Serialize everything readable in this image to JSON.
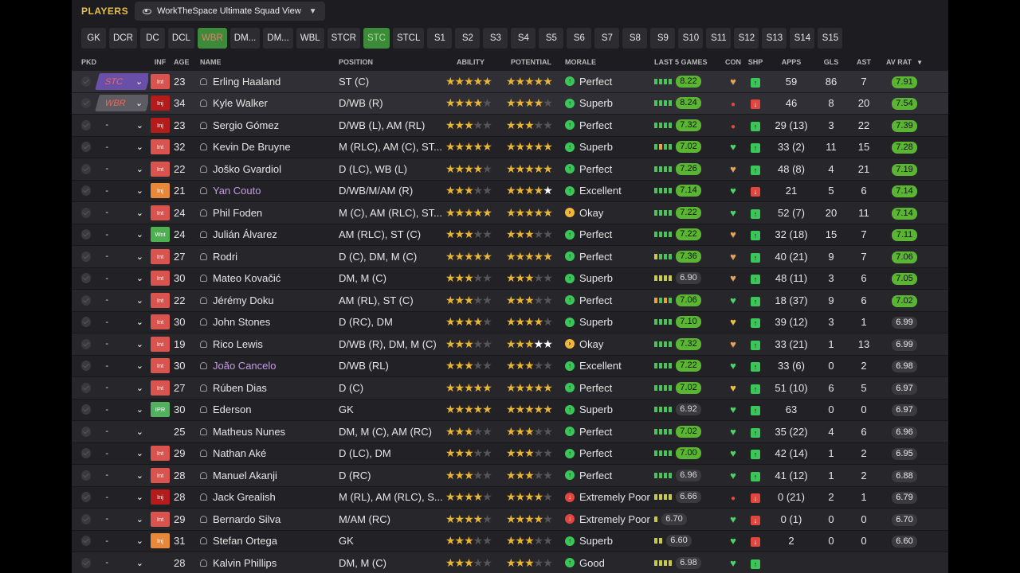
{
  "header": {
    "title": "PLAYERS",
    "view": "WorkTheSpace Ultimate Squad View"
  },
  "positions": [
    {
      "label": "GK",
      "state": ""
    },
    {
      "label": "DCR",
      "state": ""
    },
    {
      "label": "DC",
      "state": ""
    },
    {
      "label": "DCL",
      "state": ""
    },
    {
      "label": "WBR",
      "state": "active"
    },
    {
      "label": "DM...",
      "state": ""
    },
    {
      "label": "DM...",
      "state": ""
    },
    {
      "label": "WBL",
      "state": ""
    },
    {
      "label": "STCR",
      "state": ""
    },
    {
      "label": "STC",
      "state": "active2"
    },
    {
      "label": "STCL",
      "state": ""
    },
    {
      "label": "S1",
      "state": ""
    },
    {
      "label": "S2",
      "state": ""
    },
    {
      "label": "S3",
      "state": ""
    },
    {
      "label": "S4",
      "state": ""
    },
    {
      "label": "S5",
      "state": ""
    },
    {
      "label": "S6",
      "state": ""
    },
    {
      "label": "S7",
      "state": ""
    },
    {
      "label": "S8",
      "state": ""
    },
    {
      "label": "S9",
      "state": ""
    },
    {
      "label": "S10",
      "state": ""
    },
    {
      "label": "S11",
      "state": ""
    },
    {
      "label": "S12",
      "state": ""
    },
    {
      "label": "S13",
      "state": ""
    },
    {
      "label": "S14",
      "state": ""
    },
    {
      "label": "S15",
      "state": ""
    }
  ],
  "columns": {
    "pkd": "PKD",
    "inf": "INF",
    "age": "AGE",
    "name": "NAME",
    "position": "POSITION",
    "ability": "ABILITY",
    "potential": "POTENTIAL",
    "morale": "MORALE",
    "last5": "LAST 5 GAMES",
    "con": "CON",
    "shp": "SHP",
    "apps": "APPS",
    "gls": "GLS",
    "ast": "AST",
    "avrat": "AV RAT"
  },
  "players": [
    {
      "pick": "STC",
      "pickSel": "sel",
      "inf": "Int",
      "infType": "int",
      "age": "23",
      "name": "Erling Haaland",
      "loan": false,
      "position": "ST (C)",
      "ability": 5,
      "potential": 5,
      "potWhite": 0,
      "moraleIcon": "g",
      "morale": "Perfect",
      "bars": "gggg",
      "l5": "8.22",
      "l5g": true,
      "con": "h-o",
      "shp": "s-g",
      "apps": "59",
      "gls": "86",
      "ast": "7",
      "avrat": "7.91",
      "avg": true
    },
    {
      "pick": "WBR",
      "pickSel": "sel2",
      "inf": "Inj",
      "infType": "inj",
      "age": "34",
      "name": "Kyle Walker",
      "loan": false,
      "position": "D/WB (R)",
      "ability": 4,
      "potential": 4,
      "potWhite": 0,
      "moraleIcon": "g",
      "morale": "Superb",
      "bars": "gggg",
      "l5": "8.24",
      "l5g": true,
      "con": "h-r",
      "shp": "s-r",
      "apps": "46",
      "gls": "8",
      "ast": "20",
      "avrat": "7.54",
      "avg": true
    },
    {
      "pick": "-",
      "pickSel": "",
      "inf": "Inj",
      "infType": "inj",
      "age": "23",
      "name": "Sergio Gómez",
      "loan": false,
      "position": "D/WB (L), AM (RL)",
      "ability": 2.5,
      "potential": 3,
      "potWhite": 0,
      "moraleIcon": "g",
      "morale": "Perfect",
      "bars": "gggg",
      "l5": "7.32",
      "l5g": true,
      "con": "h-r",
      "shp": "s-g",
      "apps": "29 (13)",
      "gls": "3",
      "ast": "22",
      "avrat": "7.39",
      "avg": true
    },
    {
      "pick": "-",
      "pickSel": "",
      "inf": "Int",
      "infType": "int",
      "age": "32",
      "name": "Kevin De Bruyne",
      "loan": false,
      "position": "M (RLC), AM (C), ST...",
      "ability": 4.5,
      "potential": 4.5,
      "potWhite": 0,
      "moraleIcon": "g",
      "morale": "Superb",
      "bars": "gogg",
      "l5": "7.02",
      "l5g": true,
      "con": "h-g",
      "shp": "s-g",
      "apps": "33 (2)",
      "gls": "11",
      "ast": "15",
      "avrat": "7.28",
      "avg": true
    },
    {
      "pick": "-",
      "pickSel": "",
      "inf": "Int",
      "infType": "int",
      "age": "22",
      "name": "Joško Gvardiol",
      "loan": false,
      "position": "D (LC), WB (L)",
      "ability": 4,
      "potential": 4.5,
      "potWhite": 0,
      "moraleIcon": "g",
      "morale": "Perfect",
      "bars": "gggg",
      "l5": "7.26",
      "l5g": true,
      "con": "h-o",
      "shp": "s-g",
      "apps": "48 (8)",
      "gls": "4",
      "ast": "21",
      "avrat": "7.19",
      "avg": true
    },
    {
      "pick": "-",
      "pickSel": "",
      "inf": "Inj",
      "infType": "injo",
      "age": "21",
      "name": "Yan Couto",
      "loan": true,
      "position": "D/WB/M/AM (R)",
      "ability": 3,
      "potential": 4,
      "potWhite": 1,
      "moraleIcon": "g",
      "morale": "Excellent",
      "bars": "gggg",
      "l5": "7.14",
      "l5g": true,
      "con": "h-g",
      "shp": "s-r",
      "apps": "21",
      "gls": "5",
      "ast": "6",
      "avrat": "7.14",
      "avg": true
    },
    {
      "pick": "-",
      "pickSel": "",
      "inf": "Int",
      "infType": "int",
      "age": "24",
      "name": "Phil Foden",
      "loan": false,
      "position": "M (C), AM (RLC), ST...",
      "ability": 4.5,
      "potential": 4.5,
      "potWhite": 0,
      "moraleIcon": "y",
      "morale": "Okay",
      "bars": "gggg",
      "l5": "7.22",
      "l5g": true,
      "con": "h-g",
      "shp": "s-g",
      "apps": "52 (7)",
      "gls": "20",
      "ast": "11",
      "avrat": "7.14",
      "avg": true
    },
    {
      "pick": "-",
      "pickSel": "",
      "inf": "Wnt",
      "infType": "wnt",
      "age": "24",
      "name": "Julián Álvarez",
      "loan": false,
      "position": "AM (RLC), ST (C)",
      "ability": 3,
      "potential": 3,
      "potWhite": 0,
      "moraleIcon": "g",
      "morale": "Perfect",
      "bars": "gggg",
      "l5": "7.22",
      "l5g": true,
      "con": "h-o",
      "shp": "s-g",
      "apps": "32 (18)",
      "gls": "15",
      "ast": "7",
      "avrat": "7.11",
      "avg": true
    },
    {
      "pick": "-",
      "pickSel": "",
      "inf": "Int",
      "infType": "int",
      "age": "27",
      "name": "Rodri",
      "loan": false,
      "position": "D (C), DM, M (C)",
      "ability": 4.5,
      "potential": 4.5,
      "potWhite": 0,
      "moraleIcon": "g",
      "morale": "Perfect",
      "bars": "yggg",
      "l5": "7.36",
      "l5g": true,
      "con": "h-o",
      "shp": "s-g",
      "apps": "40 (21)",
      "gls": "9",
      "ast": "7",
      "avrat": "7.06",
      "avg": true
    },
    {
      "pick": "-",
      "pickSel": "",
      "inf": "Int",
      "infType": "int",
      "age": "30",
      "name": "Mateo Kovačić",
      "loan": false,
      "position": "DM, M (C)",
      "ability": 3,
      "potential": 3,
      "potWhite": 0,
      "moraleIcon": "g",
      "morale": "Superb",
      "bars": "yyyy",
      "l5": "6.90",
      "l5g": false,
      "con": "h-o",
      "shp": "s-g",
      "apps": "48 (11)",
      "gls": "3",
      "ast": "6",
      "avrat": "7.05",
      "avg": true
    },
    {
      "pick": "-",
      "pickSel": "",
      "inf": "Int",
      "infType": "int",
      "age": "22",
      "name": "Jérémy Doku",
      "loan": false,
      "position": "AM (RL), ST (C)",
      "ability": 3,
      "potential": 3,
      "potWhite": 0,
      "moraleIcon": "g",
      "morale": "Perfect",
      "bars": "ogog",
      "l5": "7.06",
      "l5g": true,
      "con": "h-g",
      "shp": "s-g",
      "apps": "18 (37)",
      "gls": "9",
      "ast": "6",
      "avrat": "7.02",
      "avg": true
    },
    {
      "pick": "-",
      "pickSel": "",
      "inf": "Int",
      "infType": "int",
      "age": "30",
      "name": "John Stones",
      "loan": false,
      "position": "D (RC), DM",
      "ability": 4,
      "potential": 4,
      "potWhite": 0,
      "moraleIcon": "g",
      "morale": "Superb",
      "bars": "gggg",
      "l5": "7.10",
      "l5g": true,
      "con": "h-y",
      "shp": "s-g",
      "apps": "39 (12)",
      "gls": "3",
      "ast": "1",
      "avrat": "6.99",
      "avg": false
    },
    {
      "pick": "-",
      "pickSel": "",
      "inf": "Int",
      "infType": "int",
      "age": "19",
      "name": "Rico Lewis",
      "loan": false,
      "position": "D/WB (R), DM, M (C)",
      "ability": 3,
      "potential": 3,
      "potWhite": 1.5,
      "moraleIcon": "y",
      "morale": "Okay",
      "bars": "gggg",
      "l5": "7.32",
      "l5g": true,
      "con": "h-o",
      "shp": "s-g",
      "apps": "33 (21)",
      "gls": "1",
      "ast": "13",
      "avrat": "6.99",
      "avg": false
    },
    {
      "pick": "-",
      "pickSel": "",
      "inf": "Int",
      "infType": "int",
      "age": "30",
      "name": "João Cancelo",
      "loan": true,
      "position": "D/WB (RL)",
      "ability": 2.5,
      "potential": 2.5,
      "potWhite": 0,
      "moraleIcon": "g",
      "morale": "Excellent",
      "bars": "gggg",
      "l5": "7.22",
      "l5g": true,
      "con": "h-g",
      "shp": "s-g",
      "apps": "33 (6)",
      "gls": "0",
      "ast": "2",
      "avrat": "6.98",
      "avg": false
    },
    {
      "pick": "-",
      "pickSel": "",
      "inf": "Int",
      "infType": "int",
      "age": "27",
      "name": "Rúben Dias",
      "loan": false,
      "position": "D (C)",
      "ability": 4.5,
      "potential": 4.5,
      "potWhite": 0,
      "moraleIcon": "g",
      "morale": "Perfect",
      "bars": "gggg",
      "l5": "7.02",
      "l5g": true,
      "con": "h-y",
      "shp": "s-g",
      "apps": "51 (10)",
      "gls": "6",
      "ast": "5",
      "avrat": "6.97",
      "avg": false
    },
    {
      "pick": "-",
      "pickSel": "",
      "inf": "IPR",
      "infType": "ipr",
      "age": "30",
      "name": "Ederson",
      "loan": false,
      "position": "GK",
      "ability": 4.5,
      "potential": 4.5,
      "potWhite": 0,
      "moraleIcon": "g",
      "morale": "Superb",
      "bars": "gggg",
      "l5": "6.92",
      "l5g": false,
      "con": "h-g",
      "shp": "s-g",
      "apps": "63",
      "gls": "0",
      "ast": "0",
      "avrat": "6.97",
      "avg": false
    },
    {
      "pick": "-",
      "pickSel": "",
      "inf": "",
      "infType": "",
      "age": "25",
      "name": "Matheus Nunes",
      "loan": false,
      "position": "DM, M (C), AM (RC)",
      "ability": 3,
      "potential": 3,
      "potWhite": 0,
      "moraleIcon": "g",
      "morale": "Perfect",
      "bars": "gggg",
      "l5": "7.02",
      "l5g": true,
      "con": "h-g",
      "shp": "s-g",
      "apps": "35 (22)",
      "gls": "4",
      "ast": "6",
      "avrat": "6.96",
      "avg": false
    },
    {
      "pick": "-",
      "pickSel": "",
      "inf": "Int",
      "infType": "int",
      "age": "29",
      "name": "Nathan Aké",
      "loan": false,
      "position": "D (LC), DM",
      "ability": 3,
      "potential": 3,
      "potWhite": 0,
      "moraleIcon": "g",
      "morale": "Perfect",
      "bars": "gggg",
      "l5": "7.00",
      "l5g": true,
      "con": "h-g",
      "shp": "s-g",
      "apps": "42 (14)",
      "gls": "1",
      "ast": "2",
      "avrat": "6.95",
      "avg": false
    },
    {
      "pick": "-",
      "pickSel": "",
      "inf": "Int",
      "infType": "int",
      "age": "28",
      "name": "Manuel Akanji",
      "loan": false,
      "position": "D (RC)",
      "ability": 3,
      "potential": 3,
      "potWhite": 0,
      "moraleIcon": "g",
      "morale": "Perfect",
      "bars": "gggg",
      "l5": "6.96",
      "l5g": false,
      "con": "h-g",
      "shp": "s-g",
      "apps": "41 (12)",
      "gls": "1",
      "ast": "2",
      "avrat": "6.88",
      "avg": false
    },
    {
      "pick": "-",
      "pickSel": "",
      "inf": "Inj",
      "infType": "inj",
      "age": "28",
      "name": "Jack Grealish",
      "loan": false,
      "position": "M (RL), AM (RLC), S...",
      "ability": 3.5,
      "potential": 3.5,
      "potWhite": 0,
      "moraleIcon": "r",
      "morale": "Extremely Poor",
      "bars": "yyyy",
      "l5": "6.66",
      "l5g": false,
      "con": "h-r",
      "shp": "s-r",
      "apps": "0 (21)",
      "gls": "2",
      "ast": "1",
      "avrat": "6.79",
      "avg": false
    },
    {
      "pick": "-",
      "pickSel": "",
      "inf": "Int",
      "infType": "int",
      "age": "29",
      "name": "Bernardo Silva",
      "loan": false,
      "position": "M/AM (RC)",
      "ability": 4,
      "potential": 4,
      "potWhite": 0,
      "moraleIcon": "r",
      "morale": "Extremely Poor",
      "bars": "y",
      "l5": "6.70",
      "l5g": false,
      "con": "h-g",
      "shp": "s-r",
      "apps": "0 (1)",
      "gls": "0",
      "ast": "0",
      "avrat": "6.70",
      "avg": false
    },
    {
      "pick": "-",
      "pickSel": "",
      "inf": "Inj",
      "infType": "injo",
      "age": "31",
      "name": "Stefan Ortega",
      "loan": false,
      "position": "GK",
      "ability": 2.5,
      "potential": 2.5,
      "potWhite": 0,
      "moraleIcon": "g",
      "morale": "Superb",
      "bars": "yy",
      "l5": "6.60",
      "l5g": false,
      "con": "h-g",
      "shp": "s-r",
      "apps": "2",
      "gls": "0",
      "ast": "0",
      "avrat": "6.60",
      "avg": false
    },
    {
      "pick": "-",
      "pickSel": "",
      "inf": "",
      "infType": "",
      "age": "28",
      "name": "Kalvin Phillips",
      "loan": false,
      "position": "DM, M (C)",
      "ability": 3,
      "potential": 3,
      "potWhite": 0,
      "moraleIcon": "g",
      "morale": "Good",
      "bars": "yyyy",
      "l5": "6.98",
      "l5g": false,
      "con": "h-g",
      "shp": "s-g",
      "apps": "",
      "gls": "",
      "ast": "",
      "avrat": "",
      "avg": false
    }
  ]
}
